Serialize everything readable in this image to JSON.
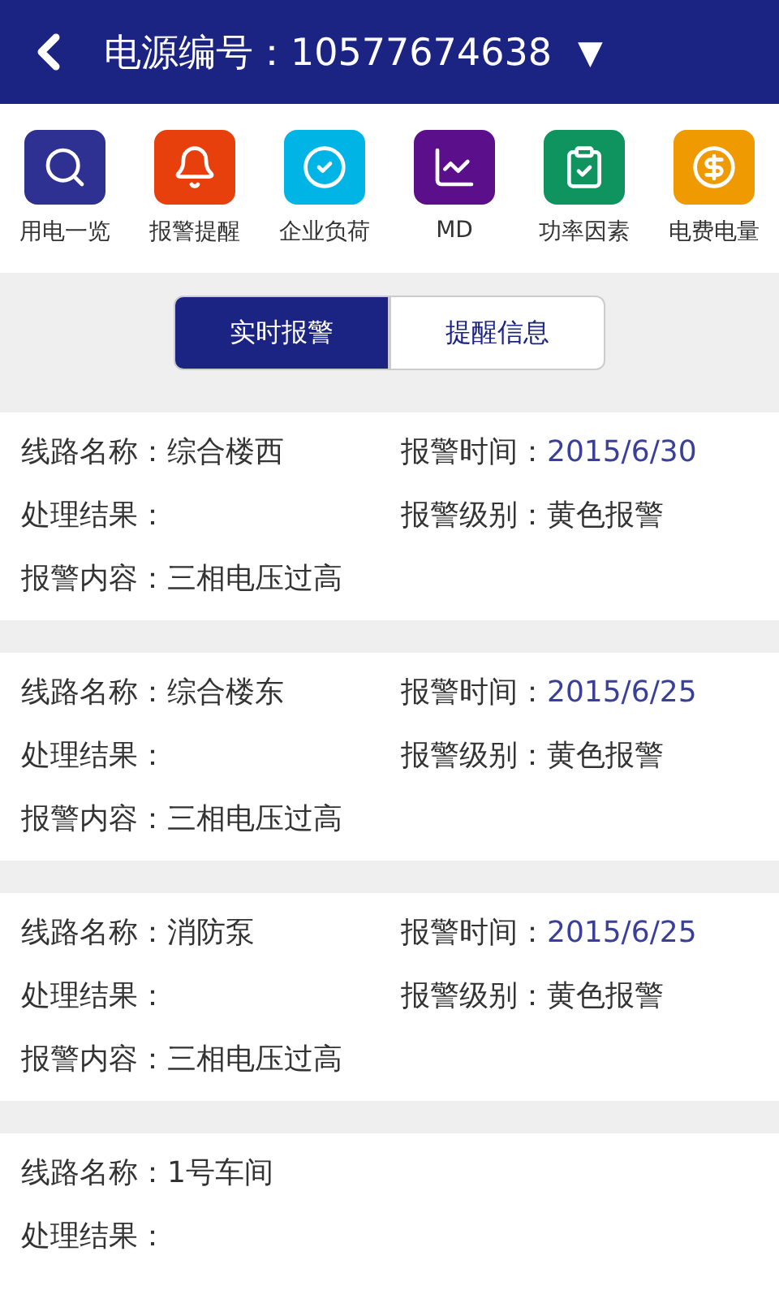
{
  "header": {
    "title": "电源编号：10577674638",
    "dropdown": "▼"
  },
  "shortcuts": [
    {
      "label": "用电一览",
      "color": "#2e3192"
    },
    {
      "label": "报警提醒",
      "color": "#e8400c"
    },
    {
      "label": "企业负荷",
      "color": "#00b4e6"
    },
    {
      "label": "MD",
      "color": "#5c0f8b"
    },
    {
      "label": "功率因素",
      "color": "#0f9460"
    },
    {
      "label": "电费电量",
      "color": "#ee9a00"
    }
  ],
  "tabs": [
    {
      "label": "实时报警",
      "selected": true
    },
    {
      "label": "提醒信息",
      "selected": false
    }
  ],
  "alarms": [
    {
      "fields": [
        {
          "label": "线路名称：",
          "value": "综合楼西"
        },
        {
          "label": "报警时间：",
          "value": "2015/6/30",
          "kind": "time"
        },
        {
          "label": "处理结果："
        },
        {
          "label": "报警级别：",
          "value": "黄色报警"
        },
        {
          "label": "报警内容：",
          "value": "三相电压过高",
          "kind": "wide"
        }
      ]
    },
    {
      "fields": [
        {
          "label": "线路名称：",
          "value": "综合楼东"
        },
        {
          "label": "报警时间：",
          "value": "2015/6/25",
          "kind": "time"
        },
        {
          "label": "处理结果："
        },
        {
          "label": "报警级别：",
          "value": "黄色报警"
        },
        {
          "label": "报警内容：",
          "value": "三相电压过高",
          "kind": "wide"
        }
      ]
    },
    {
      "fields": [
        {
          "label": "线路名称：",
          "value": "消防泵"
        },
        {
          "label": "报警时间：",
          "value": "2015/6/25",
          "kind": "time"
        },
        {
          "label": "处理结果："
        },
        {
          "label": "报警级别：",
          "value": "黄色报警"
        },
        {
          "label": "报警内容：",
          "value": "三相电压过高",
          "kind": "wide"
        }
      ]
    },
    {
      "fields": [
        {
          "label": "线路名称：",
          "value": "1号车间",
          "kind": "wide"
        },
        {
          "label": "处理结果：",
          "kind": "wide"
        }
      ]
    }
  ]
}
